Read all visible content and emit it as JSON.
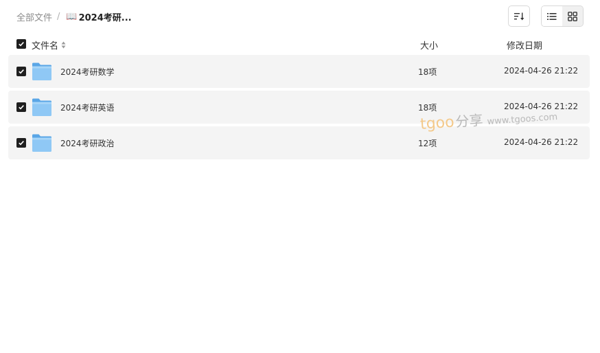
{
  "breadcrumb": {
    "root": "全部文件",
    "separator": "/",
    "current_icon": "📖",
    "current": "2024考研..."
  },
  "toolbar": {
    "sort_icon": "sort-icon",
    "list_view_icon": "list-view-icon",
    "grid_view_icon": "grid-view-icon",
    "active_view": "list"
  },
  "table": {
    "columns": {
      "name": "文件名",
      "size": "大小",
      "modified": "修改日期"
    },
    "header_checked": true,
    "rows": [
      {
        "name": "2024考研数学",
        "size": "18项",
        "modified": "2024-04-26 21:22",
        "checked": true,
        "type": "folder"
      },
      {
        "name": "2024考研英语",
        "size": "18项",
        "modified": "2024-04-26 21:22",
        "checked": true,
        "type": "folder"
      },
      {
        "name": "2024考研政治",
        "size": "12项",
        "modified": "2024-04-26 21:22",
        "checked": true,
        "type": "folder"
      }
    ]
  },
  "watermark": {
    "brand": "tgoo",
    "share": "分享",
    "url": "www.tgoos.com"
  },
  "colors": {
    "row_background": "#f4f4f4",
    "checkbox": "#1f1f1f",
    "folder": "#7cbdf0",
    "watermark_brand": "#f4c98a"
  }
}
